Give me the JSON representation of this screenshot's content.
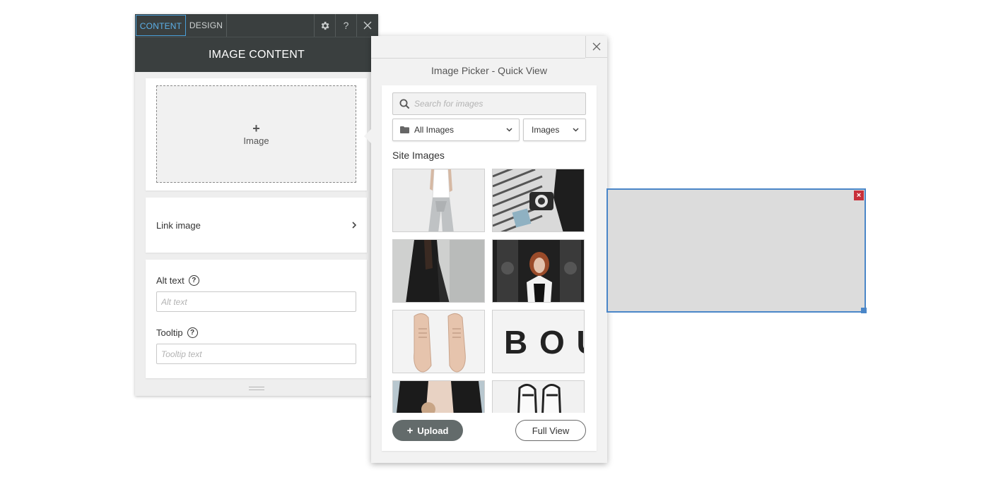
{
  "content_panel": {
    "tabs": [
      {
        "label": "CONTENT",
        "active": true
      },
      {
        "label": "DESIGN",
        "active": false
      }
    ],
    "settings_icon": "gear-icon",
    "help_label": "?",
    "close_icon": "close-icon",
    "header_title": "IMAGE CONTENT",
    "image_slot": {
      "plus": "+",
      "label": "Image"
    },
    "link_image": {
      "label": "Link image",
      "icon": "chevron-right-icon"
    },
    "alt_text": {
      "label": "Alt text",
      "help": "?",
      "placeholder": "Alt text",
      "value": ""
    },
    "tooltip": {
      "label": "Tooltip",
      "help": "?",
      "placeholder": "Tooltip text",
      "value": ""
    }
  },
  "image_picker": {
    "title": "Image Picker - Quick View",
    "close_icon": "close-icon",
    "search": {
      "placeholder": "Search for images",
      "value": "",
      "icon": "search-icon"
    },
    "folder_select": {
      "value": "All Images",
      "icon": "folder-icon"
    },
    "type_select": {
      "value": "Images"
    },
    "section_title": "Site Images",
    "thumbnails": [
      {
        "subject": "woman-white-top-grey-trousers"
      },
      {
        "subject": "flatlay-camera-stripes"
      },
      {
        "subject": "woman-black-coat"
      },
      {
        "subject": "woman-red-hair-black-door"
      },
      {
        "subject": "beige-leather-shoes"
      },
      {
        "subject": "bou-letters",
        "text": "B O U"
      },
      {
        "subject": "leather-jacket"
      },
      {
        "subject": "black-white-loafers"
      }
    ],
    "upload_label": "Upload",
    "upload_plus": "+",
    "full_view_label": "Full View"
  },
  "canvas_element": {
    "delete_icon": "×",
    "accent": "#4a86c8",
    "delete_color": "#c8303a"
  },
  "colors": {
    "panel_dark": "#3a3f3f",
    "active_tab": "#5cb0e8",
    "upload_button": "#636b6b"
  }
}
